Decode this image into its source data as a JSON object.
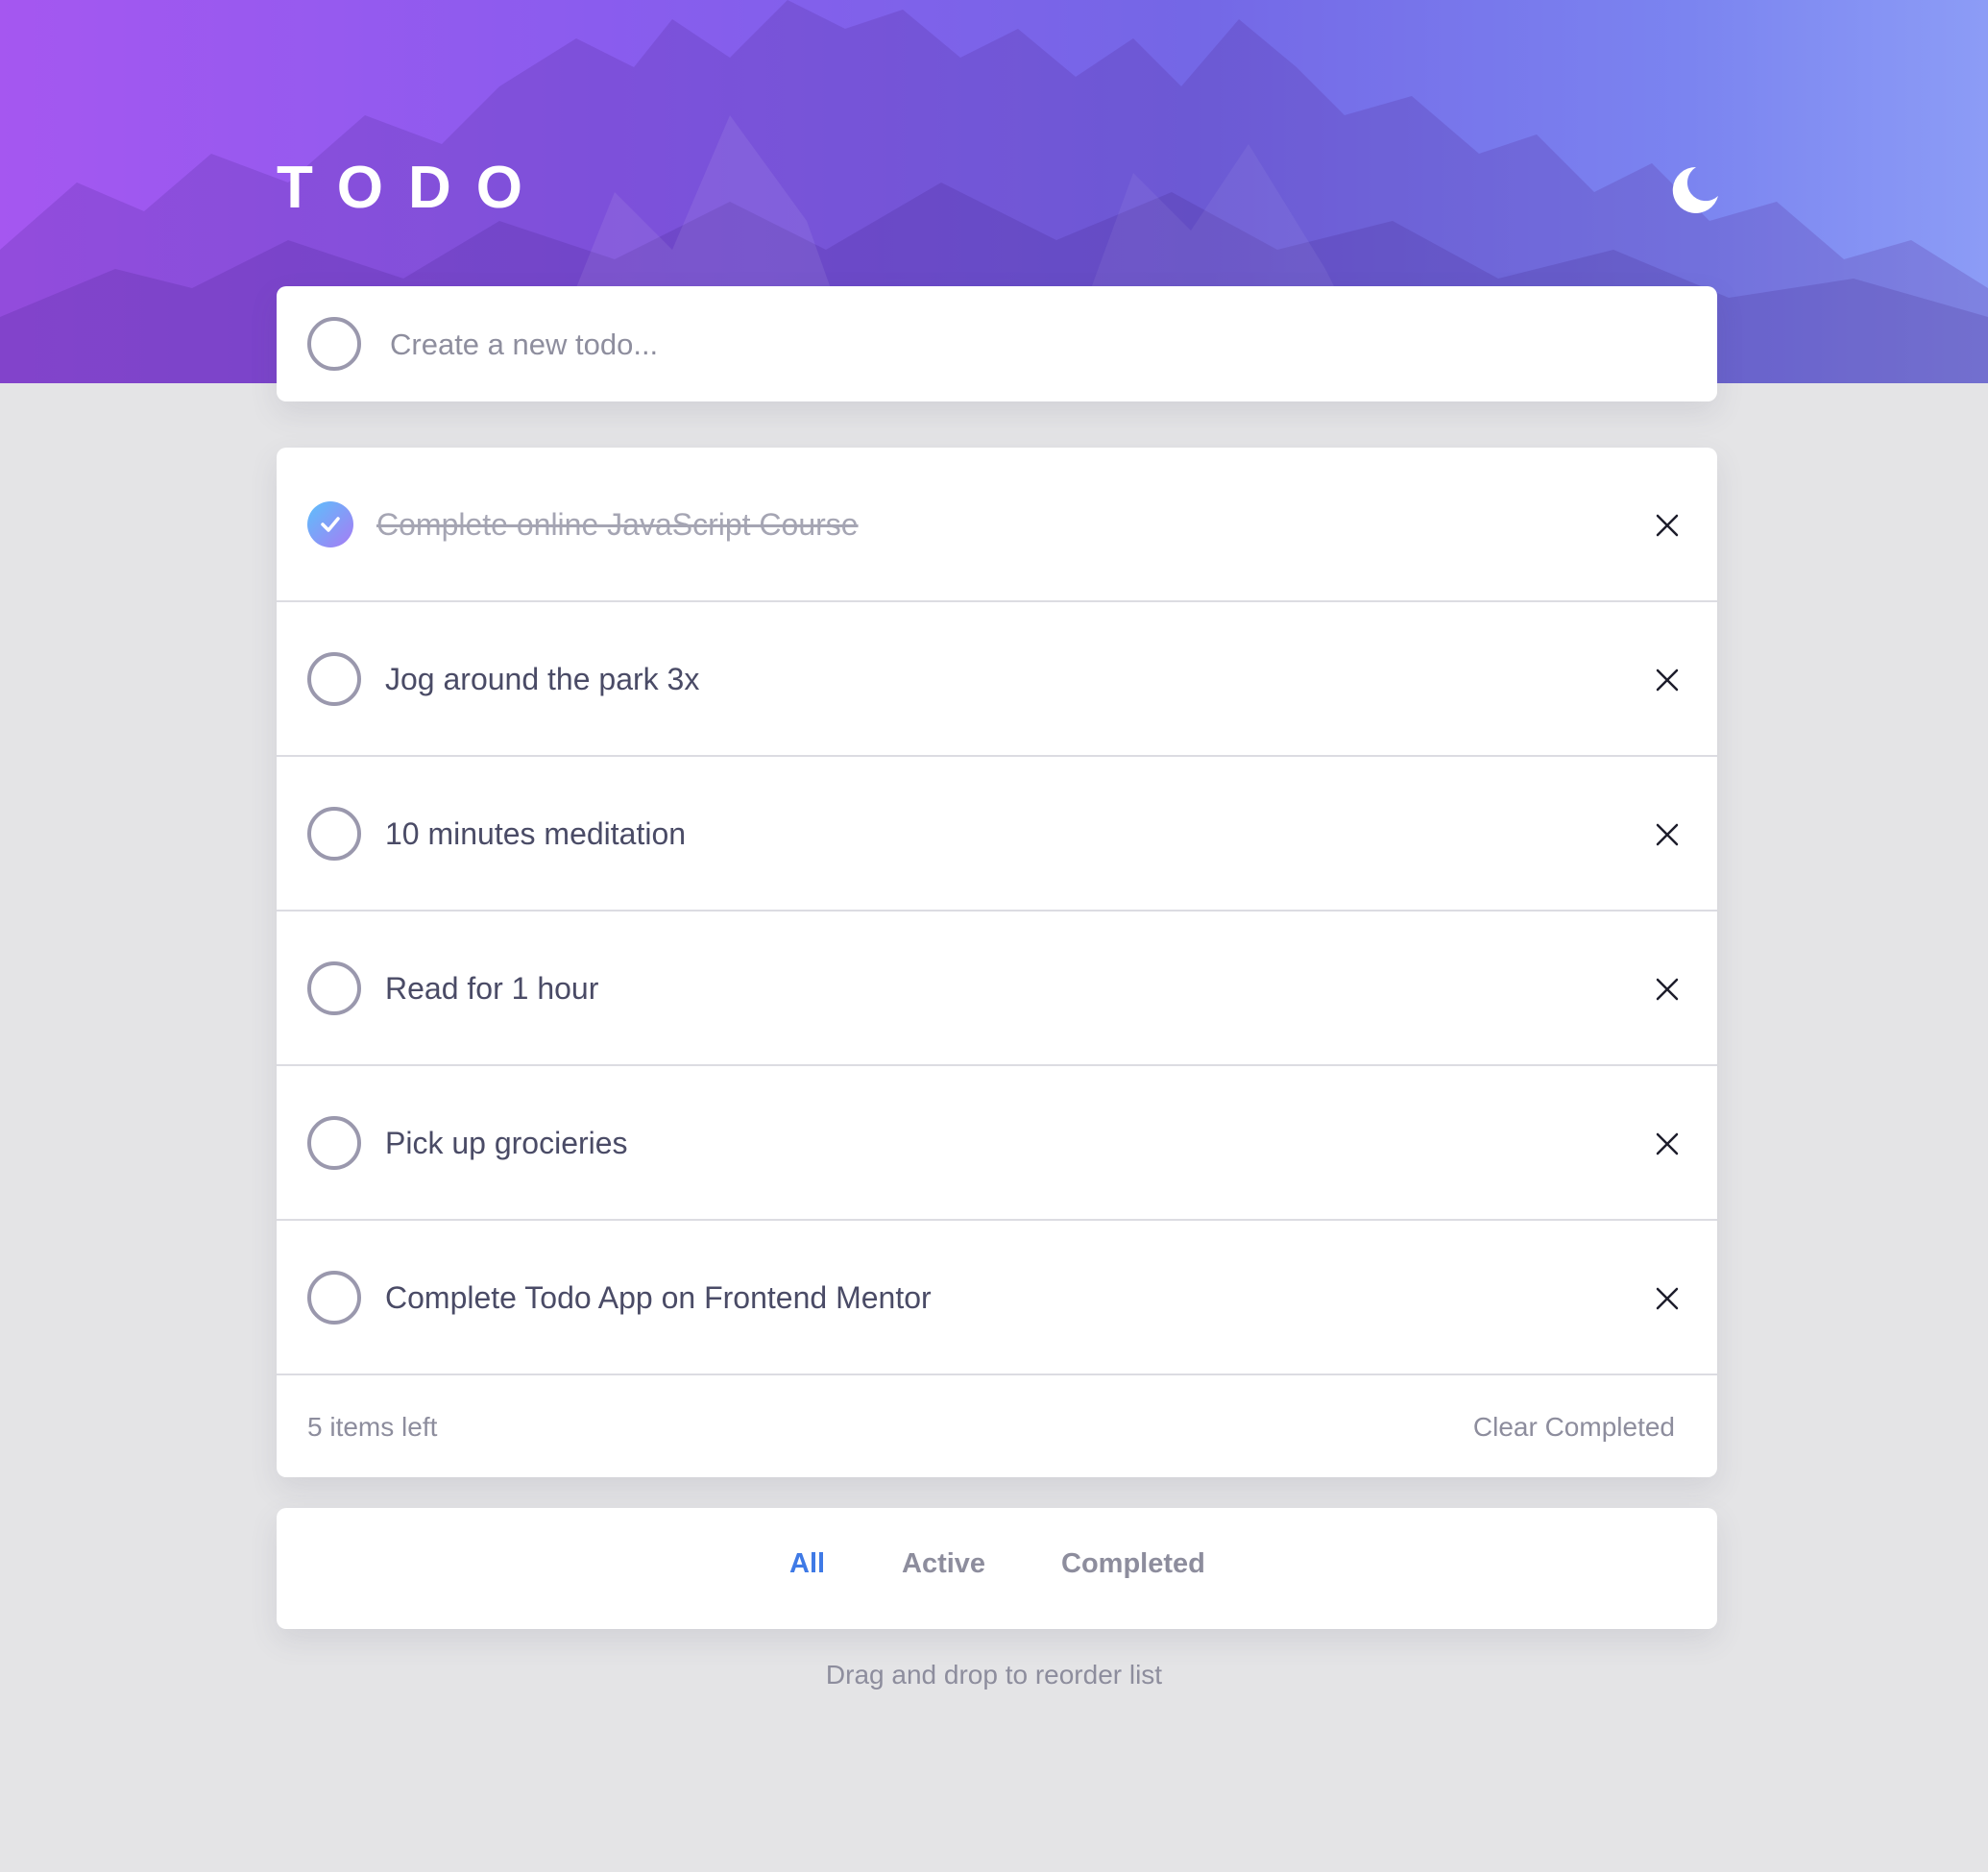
{
  "app": {
    "title": "TODO"
  },
  "theme_toggle": {
    "icon": "moon-icon"
  },
  "new_todo": {
    "placeholder": "Create a new todo..."
  },
  "todos": [
    {
      "text": "Complete online JavaScript Course",
      "completed": true
    },
    {
      "text": "Jog around the park 3x",
      "completed": false
    },
    {
      "text": "10 minutes meditation",
      "completed": false
    },
    {
      "text": "Read for 1 hour",
      "completed": false
    },
    {
      "text": "Pick up grocieries",
      "completed": false
    },
    {
      "text": "Complete Todo App on Frontend Mentor",
      "completed": false
    }
  ],
  "footer": {
    "items_left": "5 items left",
    "clear_label": "Clear Completed"
  },
  "filters": [
    {
      "label": "All",
      "active": true
    },
    {
      "label": "Active",
      "active": false
    },
    {
      "label": "Completed",
      "active": false
    }
  ],
  "hint": "Drag and drop to reorder list",
  "colors": {
    "accent": "#3f7ae6",
    "check_gradient_start": "#5cc0fb",
    "check_gradient_end": "#a77bf4",
    "page_background": "#e4e4e6"
  }
}
